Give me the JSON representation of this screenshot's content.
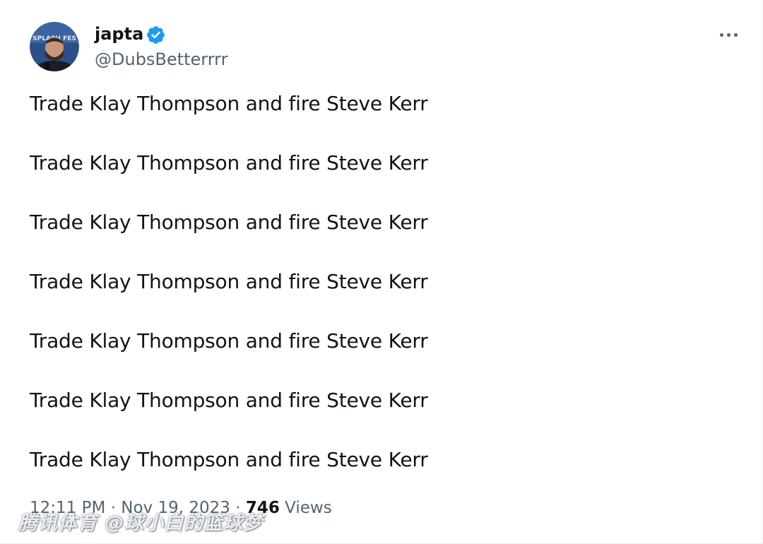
{
  "author": {
    "display_name": "japta",
    "handle": "@DubsBetterrrr",
    "verified": true,
    "verified_color": "#1d9bf0",
    "avatar_text": "SPLASH FES"
  },
  "tweet": {
    "lines": [
      "Trade Klay Thompson and fire Steve Kerr",
      "Trade Klay Thompson and fire Steve Kerr",
      "Trade Klay Thompson and fire Steve Kerr",
      "Trade Klay Thompson and fire Steve Kerr",
      "Trade Klay Thompson and fire Steve Kerr",
      "Trade Klay Thompson and fire Steve Kerr",
      "Trade Klay Thompson and fire Steve Kerr"
    ]
  },
  "meta": {
    "time": "12:11 PM",
    "separator": " · ",
    "date": "Nov 19, 2023",
    "views_count": "746",
    "views_label": "Views"
  },
  "icons": {
    "more": "more-horizontal-icon",
    "verified": "verified-badge-icon"
  },
  "watermark": {
    "text": "腾讯体育 @球小白的篮球梦"
  },
  "colors": {
    "text_primary": "#0f1419",
    "text_secondary": "#536471",
    "accent": "#1d9bf0",
    "background": "#ffffff"
  }
}
